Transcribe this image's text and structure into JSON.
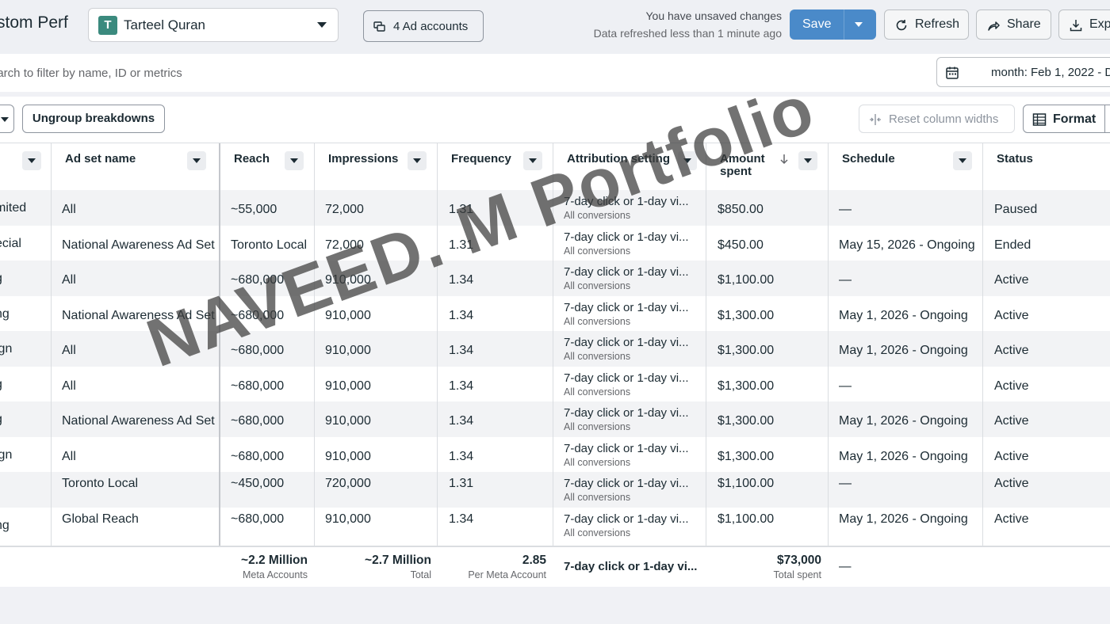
{
  "header": {
    "report_title": "stom Perf",
    "account": {
      "avatar_letter": "T",
      "name": "Tarteel Quran"
    },
    "ad_accounts_label": "4 Ad accounts",
    "unsaved_text": "You have unsaved changes",
    "refreshed_text": "Data refreshed less than 1 minute ago",
    "save_label": "Save",
    "refresh_label": "Refresh",
    "share_label": "Share",
    "export_label": "Expo",
    "save_color": "#4a8ac9"
  },
  "search": {
    "placeholder": "earch to filter by name, ID or metrics",
    "date_label": "month: Feb 1, 2022 - D"
  },
  "toolbar": {
    "ungroup_label": "Ungroup breakdowns",
    "reset_widths_label": "Reset column widths",
    "format_label": "Format"
  },
  "table": {
    "columns": {
      "adset": "Ad set name",
      "reach": "Reach",
      "impressions": "Impressions",
      "frequency": "Frequency",
      "attribution": "Attribution setting",
      "amount": "Amount spent",
      "schedule": "Schedule",
      "status": "Status"
    },
    "rows": [
      {
        "campaign": "mited",
        "adset": "All",
        "reach": "~55,000",
        "impressions": "72,000",
        "frequency": "1.31",
        "attribution": "7-day click or 1-day vi...",
        "attribution_sub": "All conversions",
        "amount": "$850.00",
        "schedule": "—",
        "status": "Paused"
      },
      {
        "campaign": "ecial",
        "adset": "National Awareness Ad Set",
        "reach": "Toronto Local",
        "impressions": "72,000",
        "frequency": "1.31",
        "attribution": "7-day click or 1-day vi...",
        "attribution_sub": "All conversions",
        "amount": "$450.00",
        "schedule": "May 15, 2026 - Ongoing",
        "status": "Ended"
      },
      {
        "campaign": "g",
        "adset": "All",
        "reach": "~680,000",
        "impressions": "910,000",
        "frequency": "1.34",
        "attribution": "7-day click or 1-day vi...",
        "attribution_sub": "All conversions",
        "amount": "$1,100.00",
        "schedule": "—",
        "status": "Active"
      },
      {
        "campaign": "ng",
        "adset": "National Awareness Ad Set",
        "reach": "~680,000",
        "impressions": "910,000",
        "frequency": "1.34",
        "attribution": "7-day click or 1-day vi...",
        "attribution_sub": "All conversions",
        "amount": "$1,300.00",
        "schedule": "May 1, 2026 - Ongoing",
        "status": "Active"
      },
      {
        "campaign": "ign",
        "adset": "All",
        "reach": "~680,000",
        "impressions": "910,000",
        "frequency": "1.34",
        "attribution": "7-day click or 1-day vi...",
        "attribution_sub": "All conversions",
        "amount": "$1,300.00",
        "schedule": "May 1, 2026 - Ongoing",
        "status": "Active"
      },
      {
        "campaign": "g",
        "adset": "All",
        "reach": "~680,000",
        "impressions": "910,000",
        "frequency": "1.34",
        "attribution": "7-day click or 1-day vi...",
        "attribution_sub": "All conversions",
        "amount": "$1,300.00",
        "schedule": "—",
        "status": "Active"
      },
      {
        "campaign": "g",
        "adset": "National Awareness Ad Set",
        "reach": "~680,000",
        "impressions": "910,000",
        "frequency": "1.34",
        "attribution": "7-day click or 1-day vi...",
        "attribution_sub": "All conversions",
        "amount": "$1,300.00",
        "schedule": "May 1, 2026 - Ongoing",
        "status": "Active"
      },
      {
        "campaign": "ign",
        "adset": "All",
        "reach": "~680,000",
        "impressions": "910,000",
        "frequency": "1.34",
        "attribution": "7-day click or 1-day vi...",
        "attribution_sub": "All conversions",
        "amount": "$1,300.00",
        "schedule": "May 1, 2026 - Ongoing",
        "status": "Active"
      },
      {
        "campaign": "",
        "adset": "Toronto Local",
        "reach": "~450,000",
        "impressions": "720,000",
        "frequency": "1.31",
        "attribution": "7-day click or 1-day vi...",
        "attribution_sub": "All conversions",
        "amount": "$1,100.00",
        "schedule": "—",
        "status": "Active"
      },
      {
        "campaign": "ng",
        "adset": "Global Reach",
        "reach": "~680,000",
        "impressions": "910,000",
        "frequency": "1.34",
        "attribution": "7-day click or 1-day vi...",
        "attribution_sub": "All conversions",
        "amount": "$1,100.00",
        "schedule": "May 1, 2026 - Ongoing",
        "status": "Active"
      }
    ],
    "totals": {
      "reach": "~2.2 Million",
      "reach_sub": "Meta Accounts",
      "impressions": "~2.7 Million",
      "impressions_sub": "Total",
      "frequency": "2.85",
      "frequency_sub": "Per Meta Account",
      "attribution": "7-day click or 1-day vi...",
      "amount": "$73,000",
      "amount_sub": "Total spent",
      "schedule": "—"
    }
  },
  "watermark": "NAVEED. M Portfolio"
}
